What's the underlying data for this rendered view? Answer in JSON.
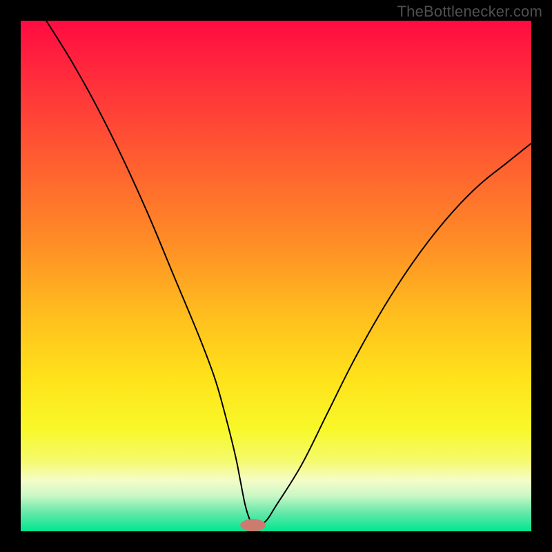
{
  "watermark": "TheBottlenecker.com",
  "colors": {
    "frame_bg": "#000000",
    "curve_stroke": "#000000",
    "marker_fill": "#cc7b6e",
    "gradient_stops": [
      {
        "offset": 0.0,
        "color": "#ff0b42"
      },
      {
        "offset": 0.12,
        "color": "#ff2f3b"
      },
      {
        "offset": 0.28,
        "color": "#ff5f30"
      },
      {
        "offset": 0.44,
        "color": "#ff8f26"
      },
      {
        "offset": 0.58,
        "color": "#ffbf1e"
      },
      {
        "offset": 0.7,
        "color": "#ffe21a"
      },
      {
        "offset": 0.8,
        "color": "#f8f829"
      },
      {
        "offset": 0.86,
        "color": "#f5fa6a"
      },
      {
        "offset": 0.9,
        "color": "#f5fcc8"
      },
      {
        "offset": 0.93,
        "color": "#caf8c6"
      },
      {
        "offset": 0.96,
        "color": "#6fe9ac"
      },
      {
        "offset": 1.0,
        "color": "#00e690"
      }
    ]
  },
  "chart_data": {
    "type": "line",
    "title": "",
    "xlabel": "",
    "ylabel": "",
    "xlim": [
      0,
      100
    ],
    "ylim": [
      0,
      100
    ],
    "grid": false,
    "legend": false,
    "x": [
      5,
      10,
      15,
      20,
      25,
      30,
      35,
      38,
      40,
      42,
      43,
      44,
      45,
      46,
      48,
      50,
      55,
      60,
      65,
      70,
      75,
      80,
      85,
      90,
      95,
      100
    ],
    "values": [
      100,
      92,
      83,
      73,
      62,
      50,
      38,
      30,
      23,
      15,
      10,
      5,
      2,
      1,
      2,
      5,
      13,
      23,
      33,
      42,
      50,
      57,
      63,
      68,
      72,
      76
    ],
    "marker": {
      "x": 45.5,
      "y": 1.2,
      "rx": 2.5,
      "ry": 1.2
    }
  }
}
